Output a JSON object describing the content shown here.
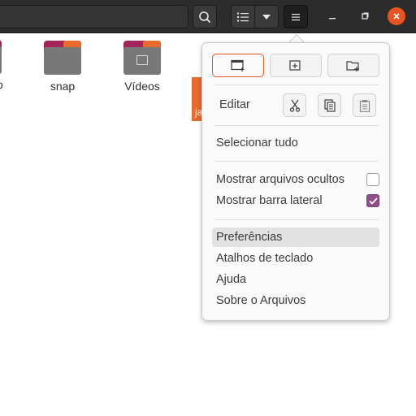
{
  "window": {
    "search_icon": "search-icon",
    "view_icon": "list-view-icon",
    "view_menu_icon": "chevron-down-icon",
    "menu_icon": "hamburger-menu-icon"
  },
  "files": [
    {
      "label_partial": "o"
    },
    {
      "label": "snap",
      "icon": "folder-icon"
    },
    {
      "label": "Vídeos",
      "icon": "videos-folder-icon"
    },
    {
      "label_partial": "ja"
    }
  ],
  "menu": {
    "top_buttons": [
      "new-window-icon",
      "new-tab-icon",
      "new-folder-icon"
    ],
    "edit_label": "Editar",
    "edit_buttons": [
      "cut-icon",
      "copy-icon",
      "paste-icon"
    ],
    "select_all": "Selecionar tudo",
    "show_hidden": {
      "label": "Mostrar arquivos ocultos",
      "checked": false
    },
    "show_sidebar": {
      "label": "Mostrar barra lateral",
      "checked": true
    },
    "preferences": "Preferências",
    "shortcuts": "Atalhos de teclado",
    "help": "Ajuda",
    "about": "Sobre o Arquivos"
  },
  "colors": {
    "accent": "#e95420",
    "checkbox_checked": "#924d8b",
    "headerbar": "#2c2c2c"
  }
}
